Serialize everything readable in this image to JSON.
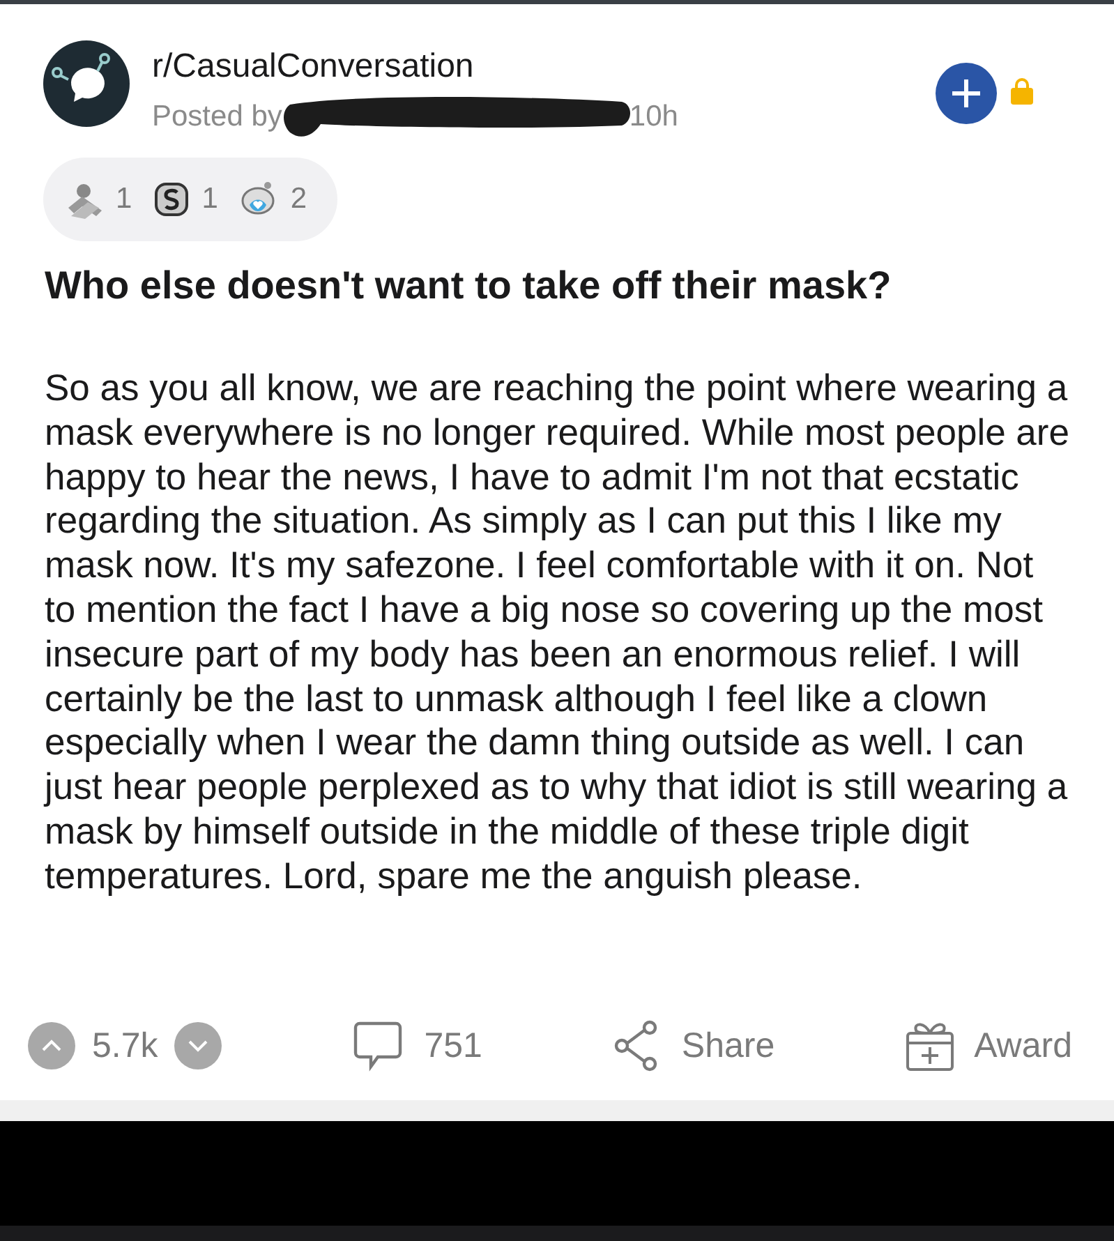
{
  "post": {
    "subreddit": "r/CasualConversation",
    "posted_by": "Posted by",
    "age": "10h",
    "joined": false,
    "locked": true
  },
  "awards": [
    {
      "kind": "handshake",
      "count": "1"
    },
    {
      "kind": "silver",
      "count": "1"
    },
    {
      "kind": "wholesome",
      "count": "2"
    }
  ],
  "title": "Who else doesn't want to take off their mask?",
  "body": "So as you all know, we are reaching the point where wearing a mask everywhere is no longer required. While most people are happy to hear the news, I have to admit I'm not that ecstatic regarding the situation. As simply as I can put this I like my mask now. It's my safezone. I feel comfortable with it on. Not to mention the fact I have a big nose so covering up the most insecure part of my body has been an enormous relief. I will certainly be the last to unmask although I feel like a clown especially when I wear the damn thing outside as well. I can just hear people perplexed as to why that idiot is still wearing a mask by himself outside in the middle of these triple digit temperatures. Lord, spare me the anguish please.",
  "actions": {
    "score": "5.7k",
    "upvoted": false,
    "downvoted": false,
    "comments": "751",
    "share": "Share",
    "award": "Award"
  }
}
